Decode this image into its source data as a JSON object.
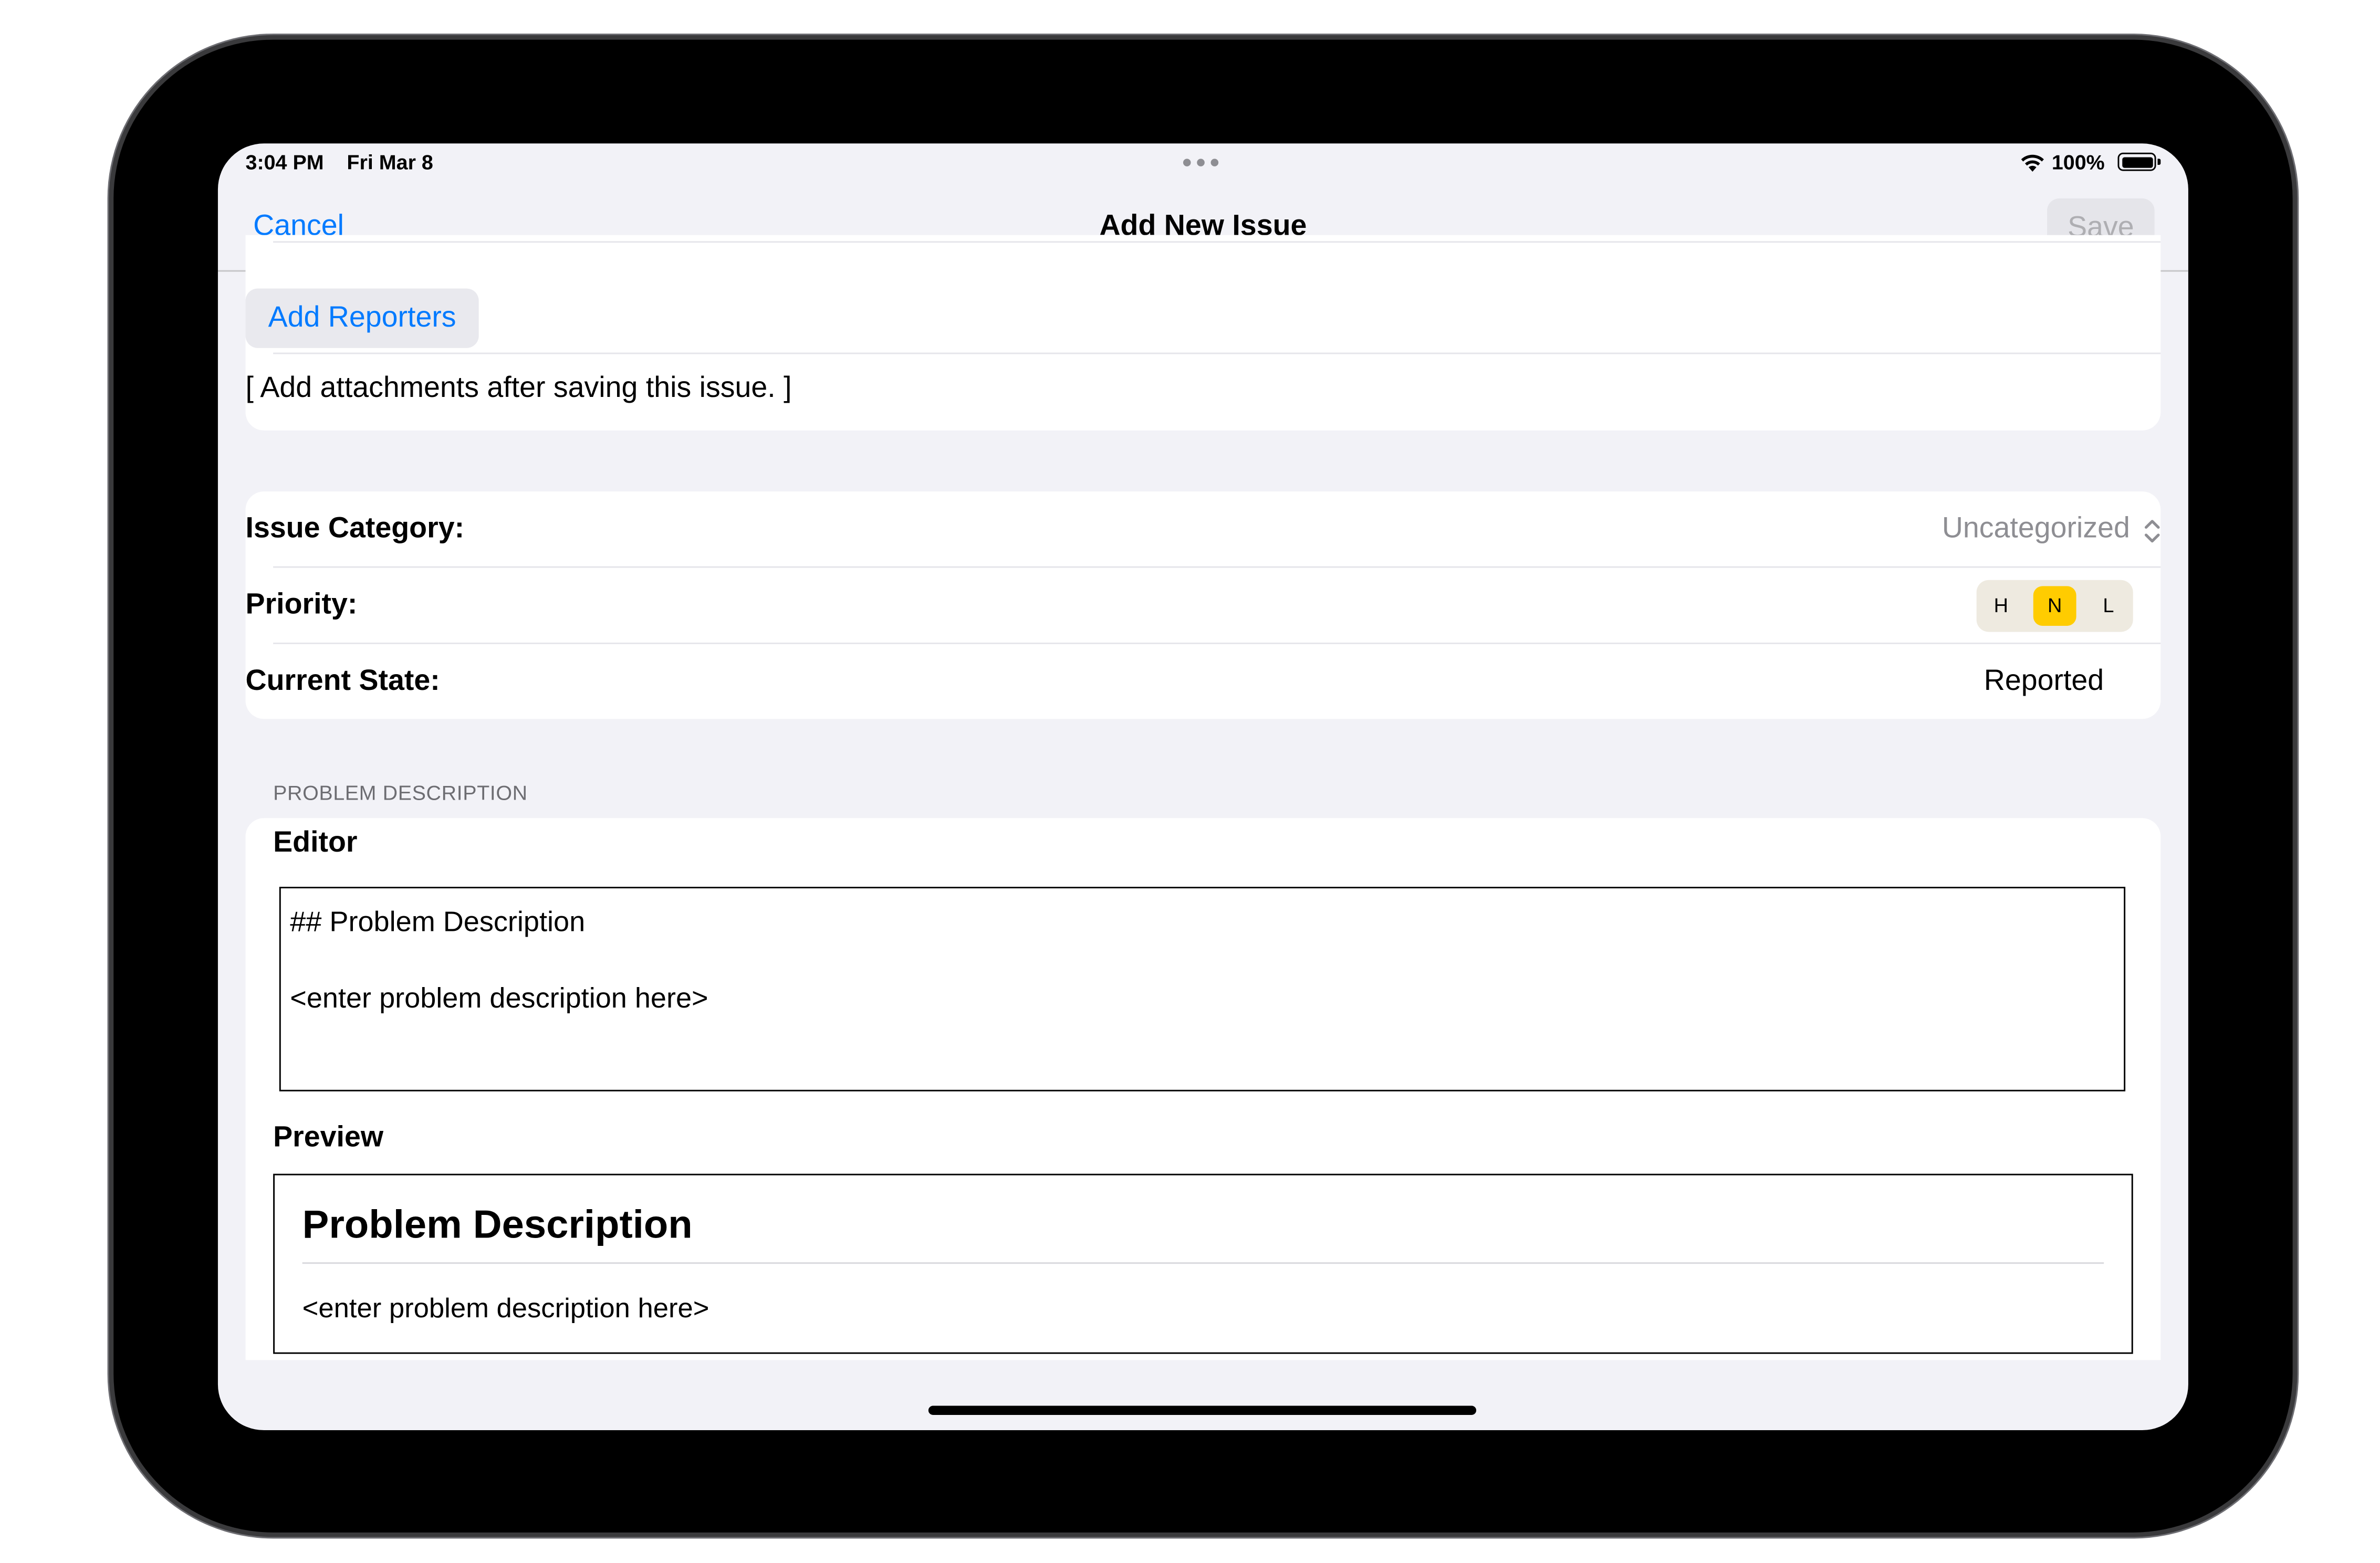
{
  "status_bar": {
    "time": "3:04 PM",
    "date": "Fri Mar 8",
    "battery_percent": "100%",
    "battery_level": 1.0
  },
  "nav": {
    "cancel_label": "Cancel",
    "title": "Add New Issue",
    "save_label": "Save"
  },
  "reporters": {
    "add_button_label": "Add Reporters",
    "attachments_note": "[ Add attachments after saving this issue. ]"
  },
  "details": {
    "category_label": "Issue Category:",
    "category_value": "Uncategorized",
    "priority_label": "Priority:",
    "priority_options": [
      "H",
      "N",
      "L"
    ],
    "priority_selected": "N",
    "state_label": "Current State:",
    "state_value": "Reported"
  },
  "description": {
    "section_header": "PROBLEM DESCRIPTION",
    "editor_label": "Editor",
    "editor_line1": "## Problem Description",
    "editor_line2": "<enter problem description here>",
    "preview_label": "Preview",
    "preview_heading": "Problem Description",
    "preview_body": "<enter problem description here>"
  },
  "colors": {
    "accent": "#007aff",
    "priority_selected": "#ffcc00",
    "background": "#f2f2f7"
  }
}
